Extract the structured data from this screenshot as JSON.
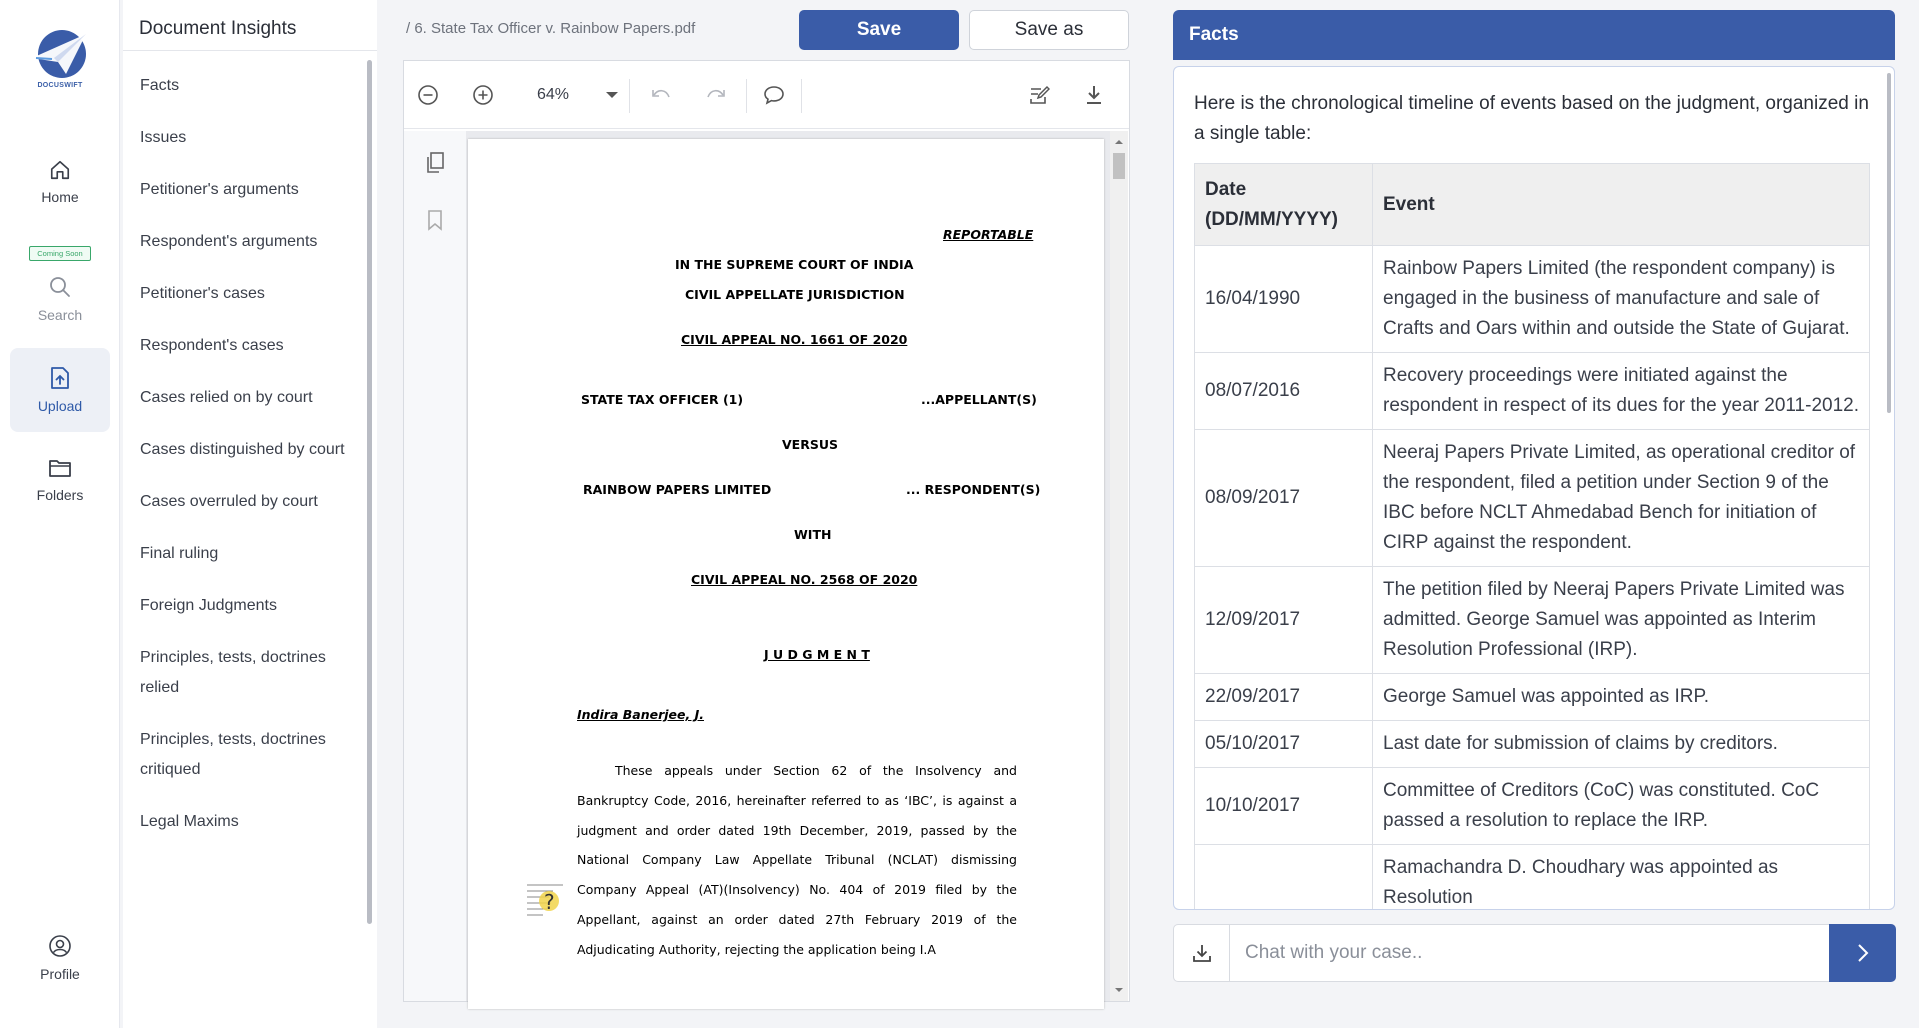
{
  "brand": {
    "logo_text": "DOCUSWIFT"
  },
  "nav": {
    "items": [
      {
        "label": "Home"
      },
      {
        "label": "Search",
        "badge": "Coming Soon"
      },
      {
        "label": "Upload"
      },
      {
        "label": "Folders"
      },
      {
        "label": "Profile"
      }
    ]
  },
  "insights": {
    "title": "Document Insights",
    "items": [
      "Facts",
      "Issues",
      "Petitioner's arguments",
      "Respondent's arguments",
      "Petitioner's cases",
      "Respondent's cases",
      "Cases relied on by court",
      "Cases distinguished by court",
      "Cases overruled by court",
      "Final ruling",
      "Foreign Judgments",
      "Principles, tests, doctrines relied",
      "Principles, tests, doctrines critiqued",
      "Legal Maxims"
    ]
  },
  "document": {
    "file_path": "/ 6. State Tax Officer v. Rainbow Papers.pdf",
    "save_label": "Save",
    "save_as_label": "Save as",
    "zoom": "64%",
    "page": {
      "reportable": "REPORTABLE",
      "court": "IN THE SUPREME COURT OF INDIA",
      "jurisdiction": "CIVIL APPELLATE JURISDICTION",
      "appeal1": "CIVIL APPEAL NO. 1661 OF 2020",
      "party1": "STATE TAX OFFICER (1)",
      "party1_role": "...APPELLANT(S)",
      "versus": "VERSUS",
      "party2": "RAINBOW PAPERS LIMITED",
      "party2_role": "... RESPONDENT(S)",
      "with": "WITH",
      "appeal2": "CIVIL APPEAL NO. 2568 OF 2020",
      "judgment": "J U D G M E N T",
      "judge": "Indira Banerjee, J.",
      "paragraph": "These appeals under Section 62 of the Insolvency and Bankruptcy Code, 2016, hereinafter referred to as ‘IBC’, is against a judgment and order dated 19th December, 2019, passed by the National Company Law Appellate Tribunal (NCLAT) dismissing Company Appeal (AT)(Insolvency) No. 404 of 2019 filed by the Appellant, against an order dated 27th February 2019 of the Adjudicating Authority, rejecting the application being I.A"
    }
  },
  "facts": {
    "title": "Facts",
    "intro": "Here is the chronological timeline of events based on the judgment, organized in a single table:",
    "columns": [
      "Date (DD/MM/YYYY)",
      "Event"
    ],
    "rows": [
      [
        "16/04/1990",
        "Rainbow Papers Limited (the respondent company) is engaged in the business of manufacture and sale of Crafts and Oars within and outside the State of Gujarat."
      ],
      [
        "08/07/2016",
        "Recovery proceedings were initiated against the respondent in respect of its dues for the year 2011-2012."
      ],
      [
        "08/09/2017",
        "Neeraj Papers Private Limited, as operational creditor of the respondent, filed a petition under Section 9 of the IBC before NCLT Ahmedabad Bench for initiation of CIRP against the respondent."
      ],
      [
        "12/09/2017",
        "The petition filed by Neeraj Papers Private Limited was admitted. George Samuel was appointed as Interim Resolution Professional (IRP)."
      ],
      [
        "22/09/2017",
        "George Samuel was appointed as IRP."
      ],
      [
        "05/10/2017",
        "Last date for submission of claims by creditors."
      ],
      [
        "10/10/2017",
        "Committee of Creditors (CoC) was constituted. CoC passed a resolution to replace the IRP."
      ],
      [
        "",
        "Ramachandra D. Choudhary was appointed as Resolution"
      ]
    ]
  },
  "chat": {
    "placeholder": "Chat with your case.."
  },
  "colors": {
    "primary": "#3a5ca8",
    "active_nav": "#2f5aa8",
    "badge": "#39a76a"
  }
}
